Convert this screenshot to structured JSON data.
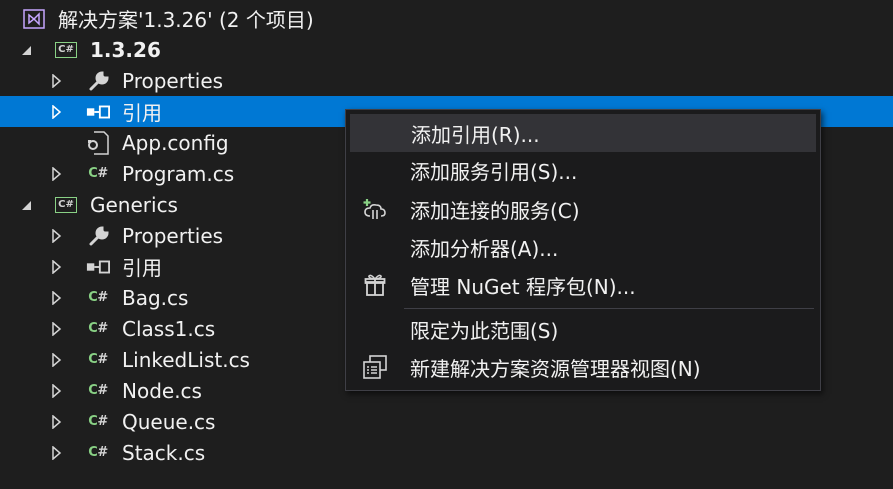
{
  "solution": {
    "title": "解决方案'1.3.26' (2 个项目)"
  },
  "projects": [
    {
      "name": "1.3.26",
      "items": [
        "Properties",
        "引用",
        "App.config",
        "Program.cs"
      ]
    },
    {
      "name": "Generics",
      "items": [
        "Properties",
        "引用",
        "Bag.cs",
        "Class1.cs",
        "LinkedList.cs",
        "Node.cs",
        "Queue.cs",
        "Stack.cs"
      ]
    }
  ],
  "context_menu": {
    "items": [
      "添加引用(R)...",
      "添加服务引用(S)...",
      "添加连接的服务(C)",
      "添加分析器(A)...",
      "管理 NuGet 程序包(N)...",
      "限定为此范围(S)",
      "新建解决方案资源管理器视图(N)"
    ]
  },
  "icons": {
    "cs_badge": "C#",
    "cs_prefix": "C",
    "cs_suffix": "#"
  },
  "colors": {
    "selection": "#0078d4",
    "background": "#1e1e1e",
    "menu_background": "#1b1b1c",
    "csharp_green": "#89d185"
  }
}
